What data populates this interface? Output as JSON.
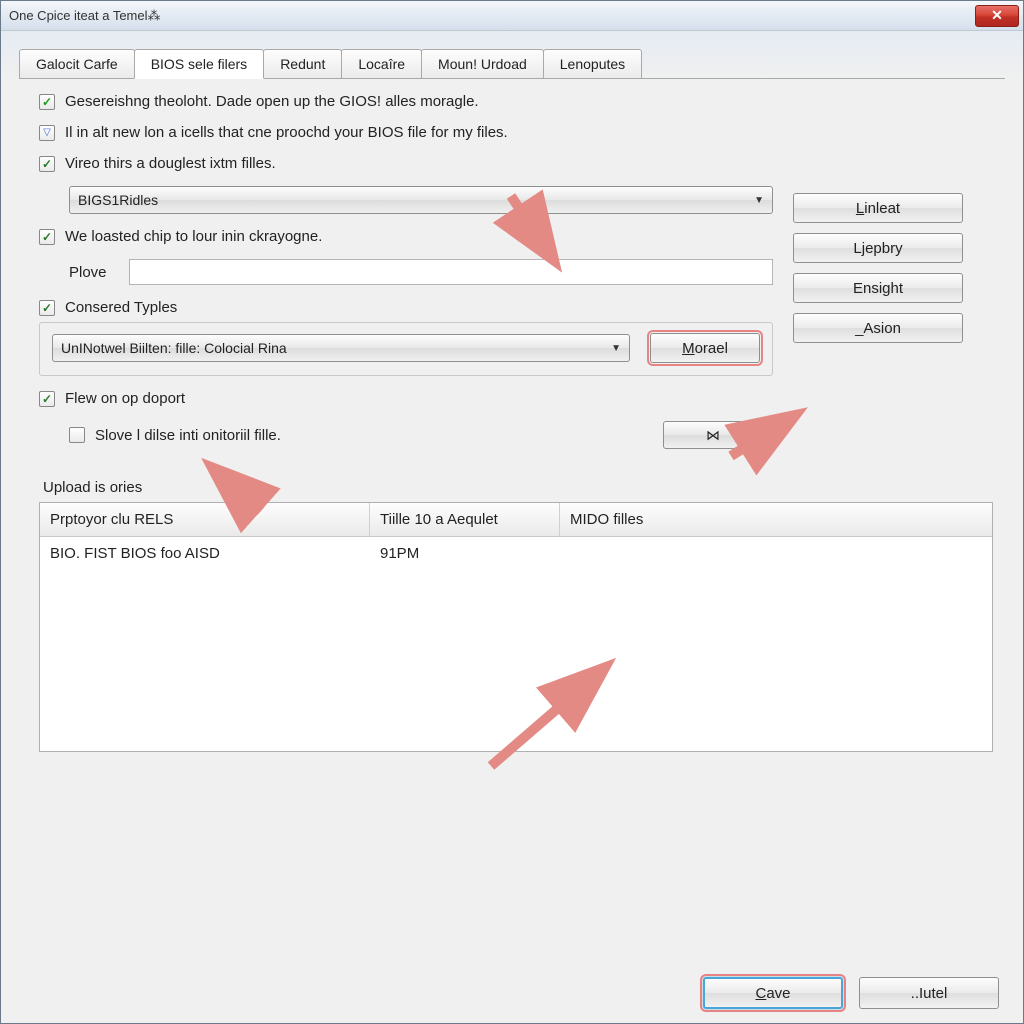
{
  "window": {
    "title": "One Cpice iteat a Temel⁂"
  },
  "tabs": [
    {
      "label": "Galocit Carfe"
    },
    {
      "label": "BIOS sele filers"
    },
    {
      "label": "Redunt"
    },
    {
      "label": "Locaîre"
    },
    {
      "label": "Moun! Urdoad"
    },
    {
      "label": "Lenoputes"
    }
  ],
  "checks": {
    "c1": "Gesereishng theoloht. Dade open up the GIOS! alles moragle.",
    "c2": "Il in alt new lon a icells that cne proochd your BIOS file for my files.",
    "c3": "Vireo thirs a douglest ixtm filles.",
    "c4": "We loasted chip to lour inin ckrayogne.",
    "c5": "Consered Typles",
    "c6": "Flew on op doport",
    "c7": "Slove l dilse inti onitoriil fille."
  },
  "fields": {
    "combo1": "BIGS1Ridles",
    "plove_label": "Plove",
    "plove_value": "",
    "combo2": "UnINotwel Biilten: fille: Colocial Rina",
    "morael_btn": "Morael",
    "small_combo": "⋈"
  },
  "right_buttons": {
    "b1": "Linleat",
    "b2": "Ljepbry",
    "b3": "Ensight",
    "b4": "_Asion"
  },
  "upload": {
    "legend": "Upload is ories",
    "headers": {
      "h1": "Prptoyor clu RELS",
      "h2": "Tiille 10 a Aequlet",
      "h3": "MIDO filles"
    },
    "rows": [
      {
        "c1": "BIO. FIST BIOS foo AISD",
        "c2": "91PM",
        "c3": ""
      }
    ]
  },
  "footer": {
    "primary": "Cave",
    "secondary": "..Iutel"
  }
}
